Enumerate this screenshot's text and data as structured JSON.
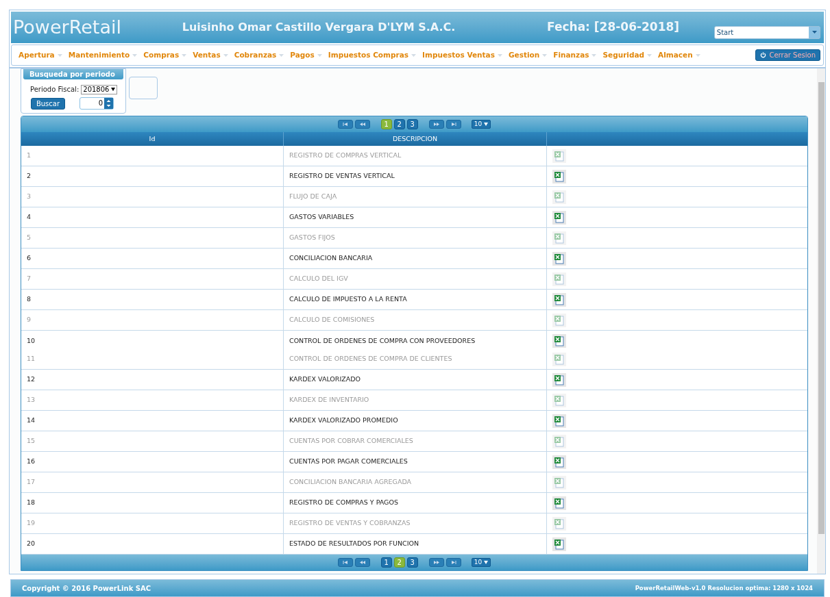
{
  "header": {
    "logo": "PowerRetail",
    "company": "Luisinho Omar Castillo Vergara D'LYM S.A.C.",
    "date": "Fecha: [28-06-2018]",
    "start_select": "Start"
  },
  "menu": [
    "Apertura",
    "Mantenimiento",
    "Compras",
    "Ventas",
    "Cobranzas",
    "Pagos",
    "Impuestos Compras",
    "Impuestos Ventas",
    "Gestion",
    "Finanzas",
    "Seguridad",
    "Almacen"
  ],
  "logout": "Cerrar Sesion",
  "search_panel": {
    "title": "Busqueda por periodo",
    "label": "Periodo Fiscal:",
    "period": "201806",
    "button": "Buscar",
    "spinner": "0"
  },
  "pagers": [
    {
      "pages": [
        {
          "label": "1",
          "selected": true
        },
        {
          "label": "2",
          "selected": false
        },
        {
          "label": "3",
          "selected": false
        }
      ],
      "page_size": "10"
    },
    {
      "pages": [
        {
          "label": "1",
          "selected": false
        },
        {
          "label": "2",
          "selected": true
        },
        {
          "label": "3",
          "selected": false
        }
      ],
      "page_size": "10"
    }
  ],
  "table": {
    "columns": [
      "Id",
      "DESCRIPCION"
    ],
    "rows": [
      {
        "id": "1",
        "desc": "REGISTRO DE COMPRAS VERTICAL",
        "dimmed": true
      },
      {
        "id": "2",
        "desc": "REGISTRO DE VENTAS VERTICAL",
        "dimmed": false
      },
      {
        "id": "3",
        "desc": "FLUJO DE CAJA",
        "dimmed": true
      },
      {
        "id": "4",
        "desc": "GASTOS VARIABLES",
        "dimmed": false
      },
      {
        "id": "5",
        "desc": "GASTOS FIJOS",
        "dimmed": true
      },
      {
        "id": "6",
        "desc": "CONCILIACION BANCARIA",
        "dimmed": false
      },
      {
        "id": "7",
        "desc": "CALCULO DEL IGV",
        "dimmed": true
      },
      {
        "id": "8",
        "desc": "CALCULO DE IMPUESTO A LA RENTA",
        "dimmed": false
      },
      {
        "id": "9",
        "desc": "CALCULO DE COMISIONES",
        "dimmed": true
      },
      {
        "id": "10",
        "desc": "CONTROL DE ORDENES DE COMPRA CON PROVEEDORES",
        "dimmed": false
      },
      {
        "id": "11",
        "desc": "CONTROL DE ORDENES DE COMPRA DE CLIENTES",
        "dimmed": true
      },
      {
        "id": "12",
        "desc": "KARDEX VALORIZADO",
        "dimmed": false
      },
      {
        "id": "13",
        "desc": "KARDEX DE INVENTARIO",
        "dimmed": true
      },
      {
        "id": "14",
        "desc": "KARDEX VALORIZADO PROMEDIO",
        "dimmed": false
      },
      {
        "id": "15",
        "desc": "CUENTAS POR COBRAR COMERCIALES",
        "dimmed": true
      },
      {
        "id": "16",
        "desc": "CUENTAS POR PAGAR COMERCIALES",
        "dimmed": false
      },
      {
        "id": "17",
        "desc": "CONCILIACION BANCARIA AGREGADA",
        "dimmed": true
      },
      {
        "id": "18",
        "desc": "REGISTRO DE COMPRAS Y PAGOS",
        "dimmed": false
      },
      {
        "id": "19",
        "desc": "REGISTRO DE VENTAS Y COBRANZAS",
        "dimmed": true
      },
      {
        "id": "20",
        "desc": "ESTADO DE RESULTADOS POR FUNCION",
        "dimmed": false
      }
    ]
  },
  "footer": {
    "copyright": "Copyright © 2016 PowerLink SAC",
    "version": "PowerRetailWeb-v1.0 Resolucion optima: 1280 x 1024"
  }
}
